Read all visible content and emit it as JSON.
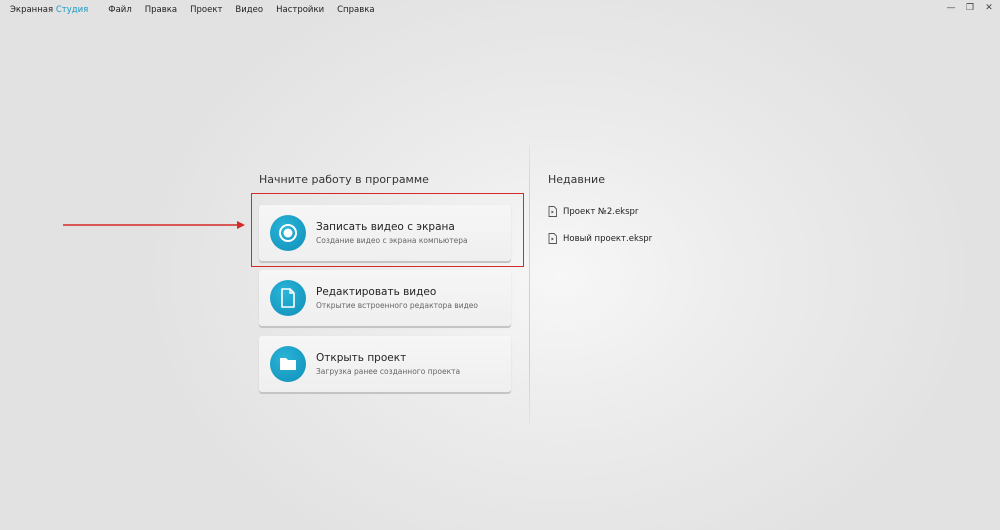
{
  "app": {
    "title_part1": "Экранная",
    "title_part2": "Студия",
    "accent_color": "#1a9bc5"
  },
  "menu": [
    "Файл",
    "Правка",
    "Проект",
    "Видео",
    "Настройки",
    "Справка"
  ],
  "window_controls": {
    "minimize": "—",
    "restore": "❐",
    "close": "✕"
  },
  "start": {
    "heading": "Начните работу в программе",
    "actions": [
      {
        "title": "Записать видео с экрана",
        "subtitle": "Создание видео с экрана компьютера",
        "icon": "record-icon"
      },
      {
        "title": "Редактировать видео",
        "subtitle": "Открытие встроенного редактора видео",
        "icon": "document-icon"
      },
      {
        "title": "Открыть проект",
        "subtitle": "Загрузка ранее созданного проекта",
        "icon": "folder-icon"
      }
    ]
  },
  "recent": {
    "heading": "Недавние",
    "items": [
      "Проект №2.ekspr",
      "Новый проект.ekspr"
    ]
  },
  "annotation": {
    "highlight_color": "#d42a2a"
  }
}
